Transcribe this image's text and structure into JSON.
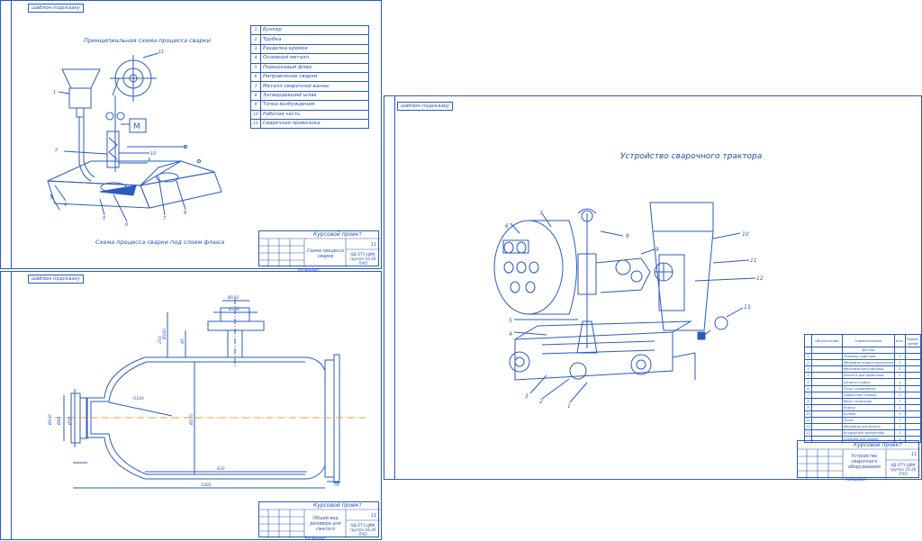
{
  "stamp_label": "шаблон подсказку",
  "sheet1": {
    "top_caption": "Принципиальная схема процесса сварки",
    "bottom_caption": "Схема процесса сварки под слоем флюса",
    "legend": [
      {
        "n": "1",
        "t": "Бункер"
      },
      {
        "n": "2",
        "t": "Трубка"
      },
      {
        "n": "3",
        "t": "Разделка кромок"
      },
      {
        "n": "4",
        "t": "Основной металл"
      },
      {
        "n": "5",
        "t": "Порошковый флюс"
      },
      {
        "n": "6",
        "t": "Направление сварки"
      },
      {
        "n": "7",
        "t": "Металл сварочной ванны"
      },
      {
        "n": "8",
        "t": "Затвердевший шлак"
      },
      {
        "n": "9",
        "t": "Точка возбуждения"
      },
      {
        "n": "10",
        "t": "Рабочая часть"
      },
      {
        "n": "11",
        "t": "Сварочная проволока"
      }
    ],
    "callouts": [
      "1",
      "2",
      "3",
      "4",
      "5",
      "6",
      "7",
      "8",
      "9",
      "10",
      "11"
    ],
    "motor_label": "М",
    "titleblock": {
      "course": "Курсовой проект",
      "name": "Схема процесса сварки",
      "group": "АД-ОТЧ ЦФК группа 10-20 ПЧО",
      "sheets": "11"
    }
  },
  "sheet2": {
    "dims": [
      "Ø160",
      "Ø100",
      "Ø80",
      "Ø50",
      "Ø270",
      "Ø330",
      "Ø180",
      "40",
      "250",
      "620",
      "1000",
      "R100",
      "50"
    ],
    "titleblock": {
      "course": "Курсовой проект",
      "name": "Общий вид ресивера для сжатого",
      "group": "АД-ОТЧ ЦФК группа 10-20 ПЧО",
      "sheets": "11"
    }
  },
  "sheet3": {
    "title": "Устройство сварочного трактора",
    "callouts": [
      "1",
      "2",
      "3",
      "4",
      "5",
      "6",
      "7",
      "8",
      "9",
      "10",
      "11",
      "12",
      "13"
    ],
    "bom_headers": [
      "Обозначение",
      "Наименование",
      "Кол.",
      "Приме-чание"
    ],
    "bom_section": "Детали",
    "bom_rows": [
      {
        "n": "1",
        "name": "Тележка трактора",
        "q": "1"
      },
      {
        "n": "2",
        "name": "Механизм подачи проволоки",
        "q": "1"
      },
      {
        "n": "3",
        "name": "Механизм регулировки",
        "q": "1"
      },
      {
        "n": "4",
        "name": "Кассета для проволоки",
        "q": "1"
      },
      {
        "n": "5",
        "name": "Штанга стойки",
        "q": "1"
      },
      {
        "n": "6",
        "name": "Пульт управления",
        "q": "1"
      },
      {
        "n": "7",
        "name": "Сварочная головка",
        "q": "1"
      },
      {
        "n": "8",
        "name": "Флюс на выходе",
        "q": "1"
      },
      {
        "n": "9",
        "name": "Корпус",
        "q": "1"
      },
      {
        "n": "10",
        "name": "Бункер",
        "q": "1"
      },
      {
        "n": "11",
        "name": "Ручка",
        "q": "1"
      },
      {
        "n": "12",
        "name": "Механизм для флюса",
        "q": "1"
      },
      {
        "n": "13",
        "name": "Воздушный наконечник",
        "q": "1"
      },
      {
        "n": "",
        "name": "Спойлер для сварки",
        "q": "1"
      }
    ],
    "titleblock": {
      "course": "Курсовой проект",
      "name": "Устройство сварочного оборудования",
      "group": "АД-ОТЧ ЦФК группа 10-20 ПЧО",
      "sheets": "11"
    }
  },
  "copy_label": "Копировал"
}
